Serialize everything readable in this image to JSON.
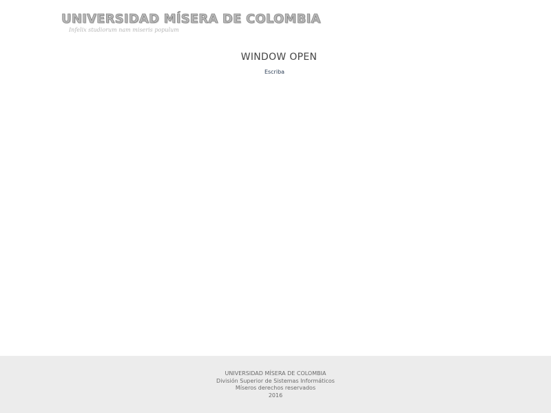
{
  "header": {
    "logo_title": "UNIVERSIDAD MÍSERA DE COLOMBIA",
    "motto": "Infelix studiorum nam miseris populum"
  },
  "main": {
    "title": "WINDOW OPEN",
    "link_label": "Escriba"
  },
  "footer": {
    "line1": "UNIVERSIDAD MÍSERA DE COLOMBIA",
    "line2": "División Superior de Sistemas Informáticos",
    "line3": "Míseros derechos reservados",
    "line4": "2016"
  }
}
